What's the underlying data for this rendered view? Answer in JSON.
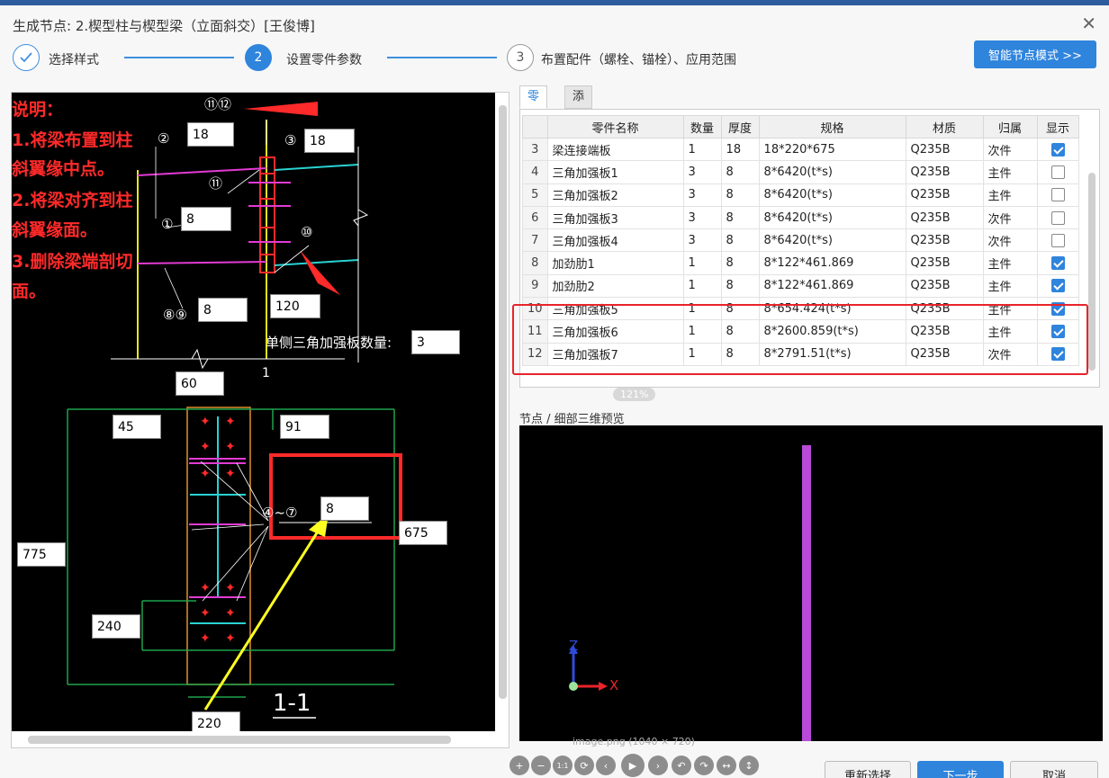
{
  "window": {
    "title": "生成节点: 2.楔型柱与楔型梁（立面斜交）[王俊博]",
    "close_glyph": "✕"
  },
  "steps": [
    {
      "num": "",
      "label": "选择样式"
    },
    {
      "num": "2",
      "label": "设置零件参数"
    },
    {
      "num": "3",
      "label": "布置配件（螺栓、锚栓）、应用范围"
    }
  ],
  "smart_button": "智能节点模式 >>",
  "notes": [
    "说明：",
    "1.将梁布置到柱",
    "斜翼缘中点。",
    "2.将梁对齐到柱",
    "斜翼缘面。",
    "3.删除梁端剖切",
    "面。"
  ],
  "drawing": {
    "inputs": {
      "top_left": "18",
      "top_right": "18",
      "web": "8",
      "plate89": "8",
      "w120": "120",
      "count": "3",
      "w60": "60",
      "w45": "45",
      "w91": "91",
      "h775": "775",
      "h675": "675",
      "stiff": "8",
      "h240": "240",
      "w220": "220"
    },
    "count_label": "单侧三角加强板数量:",
    "marks": {
      "m1112": "⑪⑫",
      "m2": "②",
      "m3": "③",
      "m11": "⑪",
      "m1": "①",
      "m10": "⑩",
      "m89": "⑧⑨",
      "m47": "④~⑦"
    },
    "section_label": "1-1",
    "cut_mark": "1"
  },
  "tabs": [
    "零件",
    "添加零件"
  ],
  "table": {
    "headers": [
      "",
      "零件名称",
      "数量",
      "厚度",
      "规格",
      "材质",
      "归属",
      "显示"
    ],
    "rows": [
      {
        "no": "3",
        "name": "梁连接端板",
        "qty": "1",
        "thk": "18",
        "spec": "18*220*675",
        "mat": "Q235B",
        "own": "次件",
        "show": true
      },
      {
        "no": "4",
        "name": "三角加强板1",
        "qty": "3",
        "thk": "8",
        "spec": "8*6420(t*s)",
        "mat": "Q235B",
        "own": "主件",
        "show": false
      },
      {
        "no": "5",
        "name": "三角加强板2",
        "qty": "3",
        "thk": "8",
        "spec": "8*6420(t*s)",
        "mat": "Q235B",
        "own": "主件",
        "show": false
      },
      {
        "no": "6",
        "name": "三角加强板3",
        "qty": "3",
        "thk": "8",
        "spec": "8*6420(t*s)",
        "mat": "Q235B",
        "own": "次件",
        "show": false
      },
      {
        "no": "7",
        "name": "三角加强板4",
        "qty": "3",
        "thk": "8",
        "spec": "8*6420(t*s)",
        "mat": "Q235B",
        "own": "次件",
        "show": false
      },
      {
        "no": "8",
        "name": "加劲肋1",
        "qty": "1",
        "thk": "8",
        "spec": "8*122*461.869",
        "mat": "Q235B",
        "own": "主件",
        "show": true
      },
      {
        "no": "9",
        "name": "加劲肋2",
        "qty": "1",
        "thk": "8",
        "spec": "8*122*461.869",
        "mat": "Q235B",
        "own": "主件",
        "show": true
      },
      {
        "no": "10",
        "name": "三角加强板5",
        "qty": "1",
        "thk": "8",
        "spec": "8*654.424(t*s)",
        "mat": "Q235B",
        "own": "主件",
        "show": true
      },
      {
        "no": "11",
        "name": "三角加强板6",
        "qty": "1",
        "thk": "8",
        "spec": "8*2600.859(t*s)",
        "mat": "Q235B",
        "own": "主件",
        "show": true
      },
      {
        "no": "12",
        "name": "三角加强板7",
        "qty": "1",
        "thk": "8",
        "spec": "8*2791.51(t*s)",
        "mat": "Q235B",
        "own": "次件",
        "show": true
      }
    ]
  },
  "zoom": "121%",
  "preview": {
    "label": "节点 / 细部三维预览",
    "caption": "image.png (1040 × 720)",
    "axis_z": "Z",
    "axis_x": "X"
  },
  "toolbar": [
    "+",
    "−",
    "1:1",
    "⟳",
    "‹",
    "▶",
    "›",
    "↶",
    "↷",
    "↔",
    "↕"
  ],
  "buttons": {
    "reselect": "重新选择",
    "next": "下一步",
    "cancel": "取消"
  }
}
